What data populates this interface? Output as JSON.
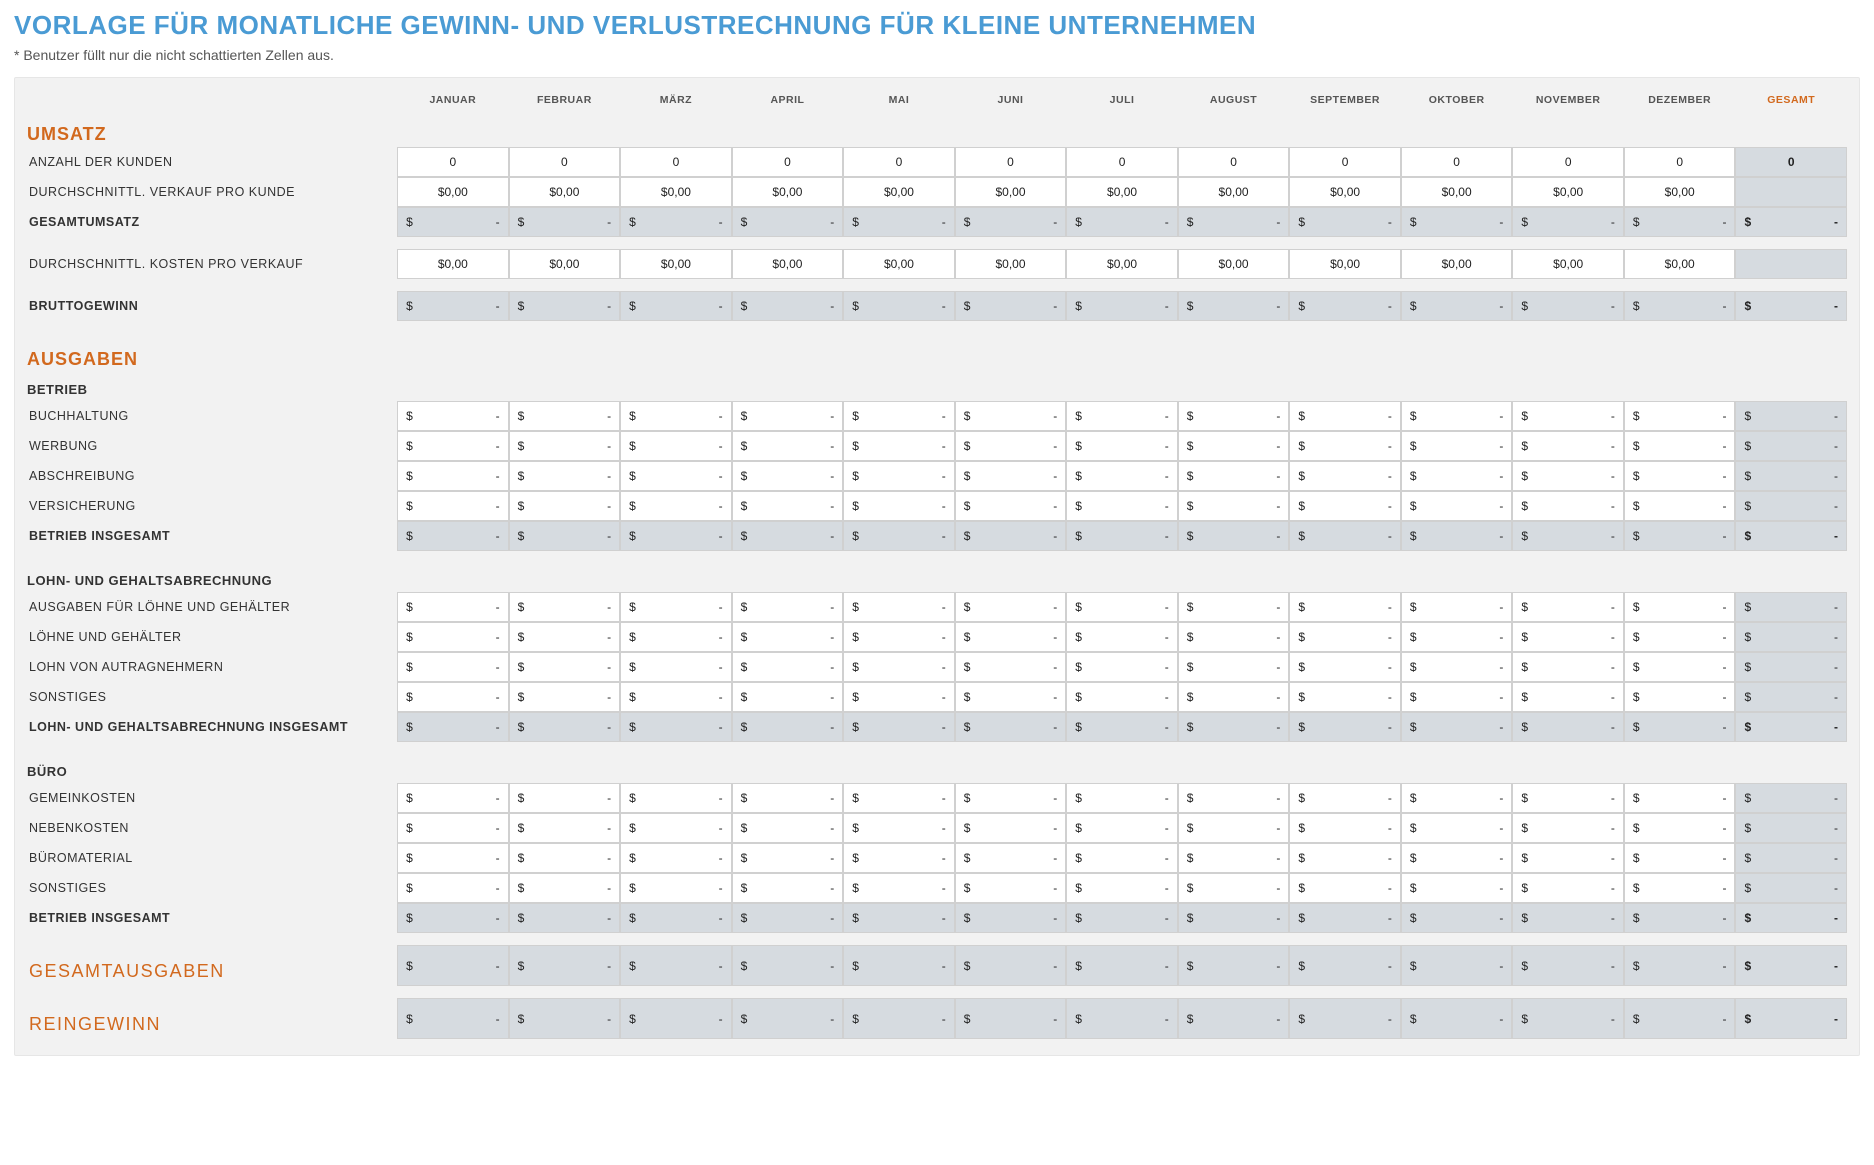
{
  "title": "VORLAGE FÜR MONATLICHE GEWINN- UND VERLUSTRECHNUNG FÜR KLEINE UNTERNEHMEN",
  "note": "* Benutzer füllt nur die nicht schattierten Zellen aus.",
  "months": [
    "JANUAR",
    "FEBRUAR",
    "MÄRZ",
    "APRIL",
    "MAI",
    "JUNI",
    "JULI",
    "AUGUST",
    "SEPTEMBER",
    "OKTOBER",
    "NOVEMBER",
    "DEZEMBER"
  ],
  "total_label": "GESAMT",
  "currency_symbol": "$",
  "empty_dash": "-",
  "values": {
    "zero_number": "0",
    "zero_currency": "$0,00"
  },
  "revenue": {
    "section_title": "UMSATZ",
    "customers_label": "ANZAHL DER KUNDEN",
    "avg_sale_label": "DURCHSCHNITTL. VERKAUF PRO KUNDE",
    "total_revenue_label": "GESAMTUMSATZ",
    "avg_cost_label": "DURCHSCHNITTL. KOSTEN PRO VERKAUF",
    "gross_profit_label": "BRUTTOGEWINN"
  },
  "expenses": {
    "section_title": "AUSGABEN",
    "operations": {
      "title": "BETRIEB",
      "items": [
        "BUCHHALTUNG",
        "WERBUNG",
        "ABSCHREIBUNG",
        "VERSICHERUNG"
      ],
      "subtotal_label": "BETRIEB INSGESAMT"
    },
    "payroll": {
      "title": "LOHN- UND GEHALTSABRECHNUNG",
      "items": [
        "AUSGABEN FÜR LÖHNE UND GEHÄLTER",
        "LÖHNE UND GEHÄLTER",
        "LOHN VON AUTRAGNEHMERN",
        "SONSTIGES"
      ],
      "subtotal_label": "LOHN- UND GEHALTSABRECHNUNG INSGESAMT"
    },
    "office": {
      "title": "BÜRO",
      "items": [
        "GEMEINKOSTEN",
        "NEBENKOSTEN",
        "BÜROMATERIAL",
        "SONSTIGES"
      ],
      "subtotal_label": "BETRIEB INSGESAMT"
    },
    "total_expenses_label": "GESAMTAUSGABEN",
    "net_profit_label": "REINGEWINN"
  }
}
